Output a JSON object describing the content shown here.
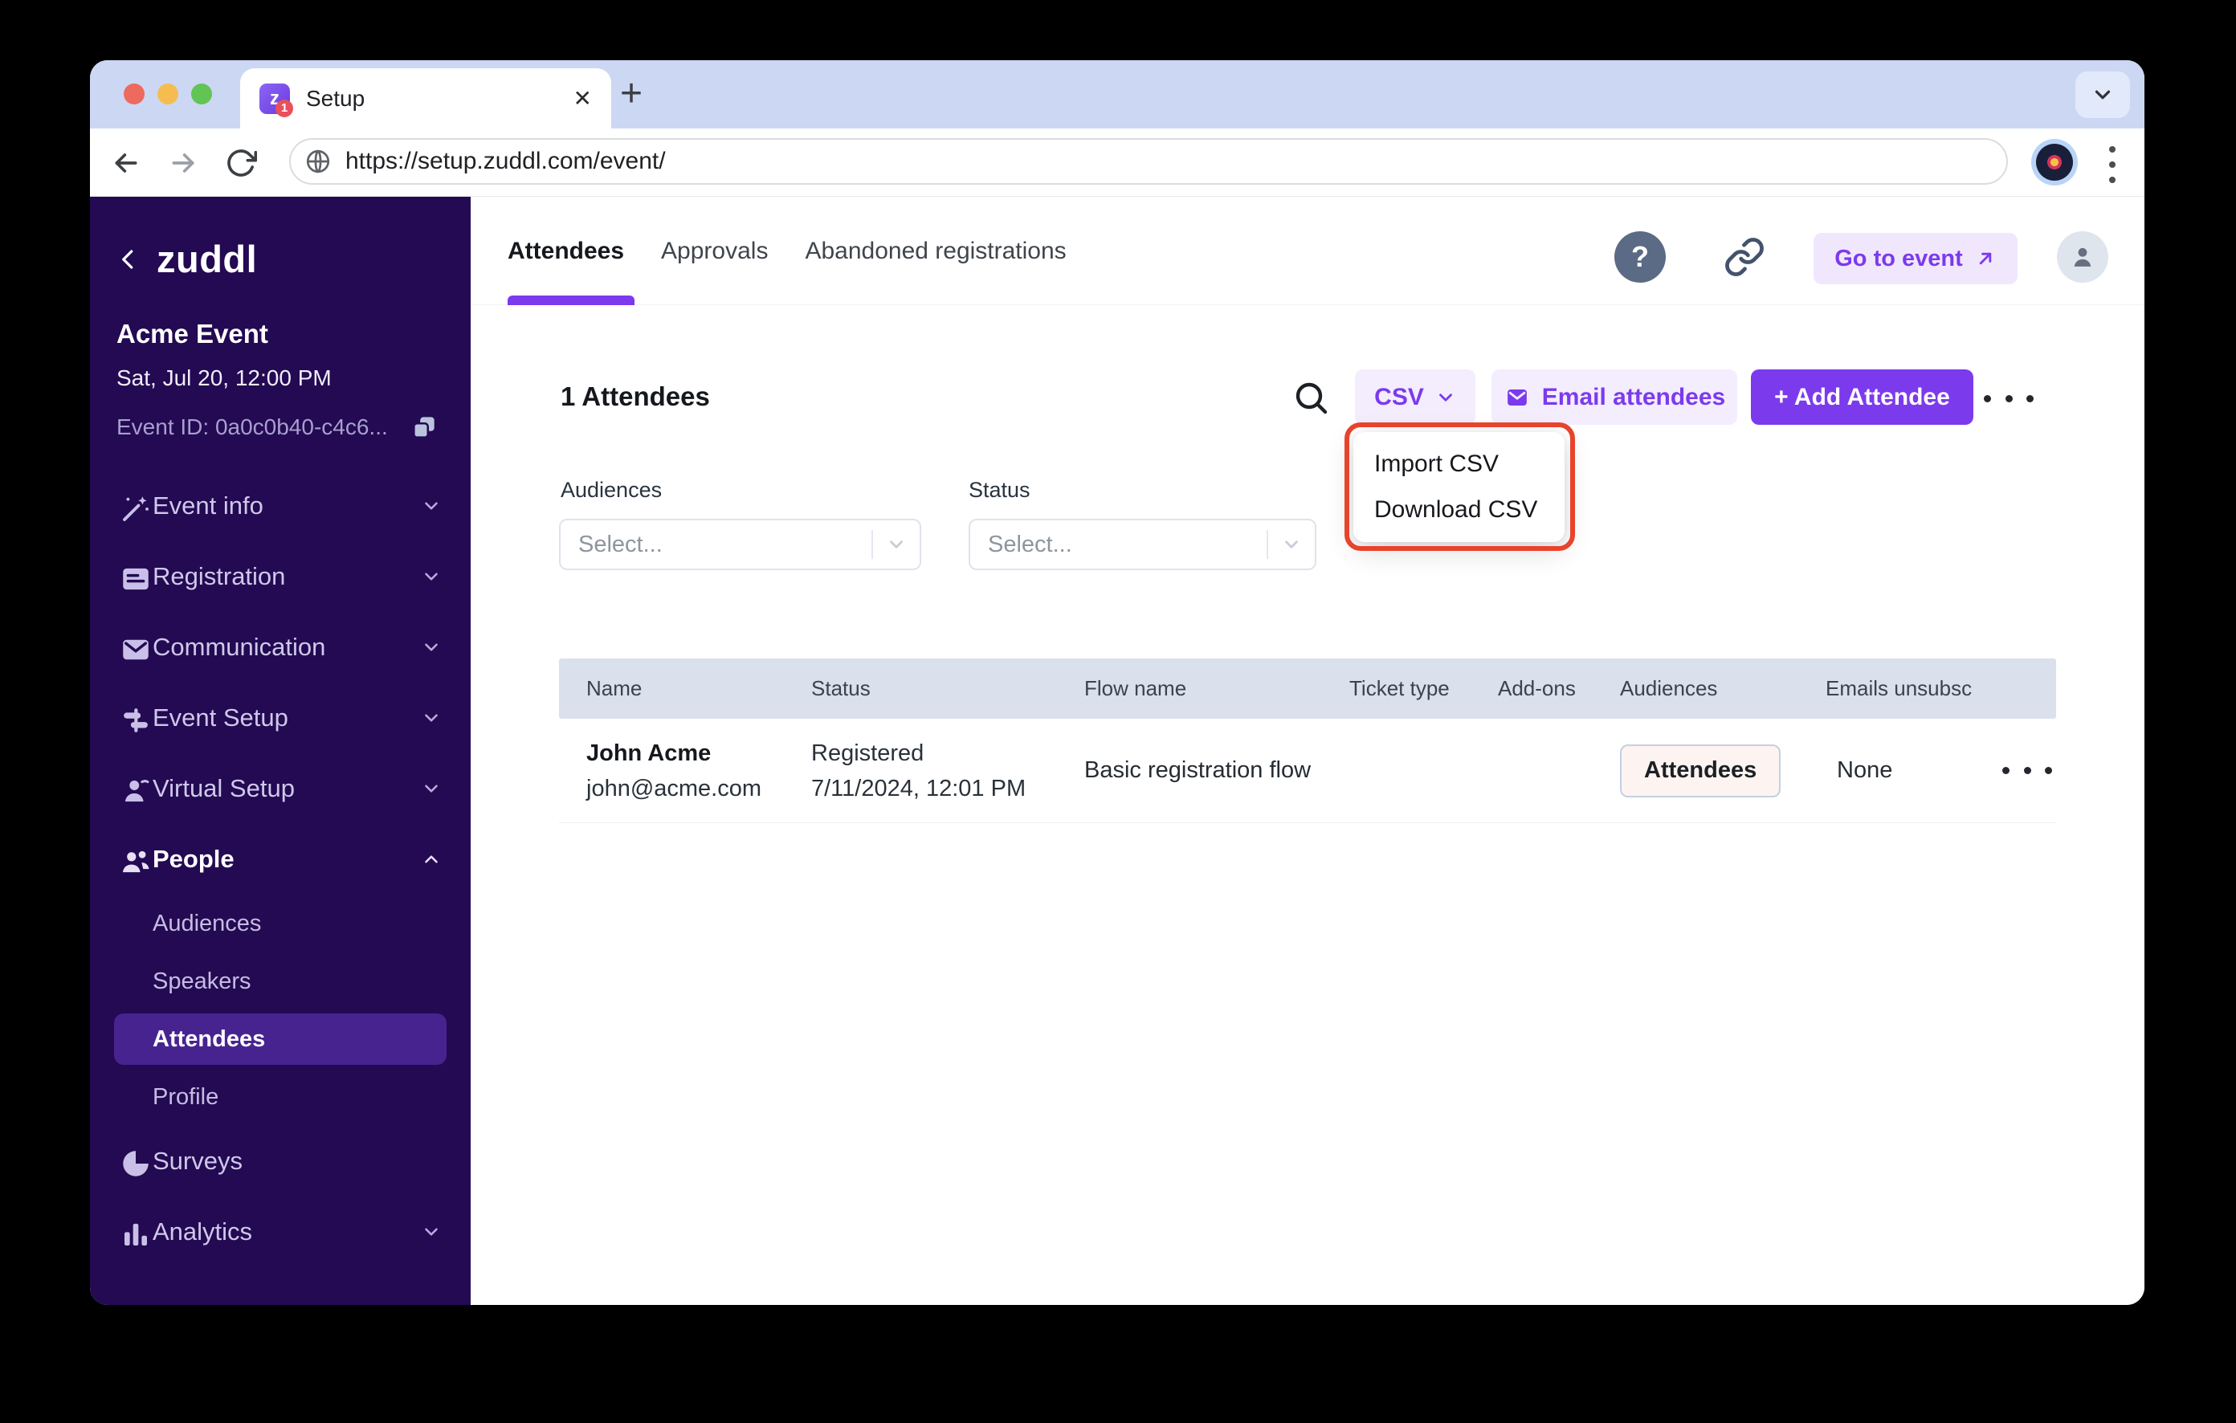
{
  "browser": {
    "tab_title": "Setup",
    "favicon_badge": "1",
    "url": "https://setup.zuddl.com/event/"
  },
  "sidebar": {
    "logo_text": "zuddl",
    "event_name": "Acme Event",
    "event_datetime": "Sat, Jul 20, 12:00 PM",
    "event_id": "Event ID: 0a0c0b40-c4c6...",
    "nav": [
      {
        "label": "Event info"
      },
      {
        "label": "Registration"
      },
      {
        "label": "Communication"
      },
      {
        "label": "Event Setup"
      },
      {
        "label": "Virtual Setup"
      },
      {
        "label": "People"
      },
      {
        "label": "Audiences"
      },
      {
        "label": "Speakers"
      },
      {
        "label": "Attendees"
      },
      {
        "label": "Profile"
      },
      {
        "label": "Surveys"
      },
      {
        "label": "Analytics"
      }
    ]
  },
  "header": {
    "tabs": [
      {
        "label": "Attendees"
      },
      {
        "label": "Approvals"
      },
      {
        "label": "Abandoned registrations"
      }
    ],
    "help_label": "?",
    "go_to_event_label": "Go to event"
  },
  "toolbar": {
    "count_title": "1 Attendees",
    "csv_label": "CSV",
    "email_label": "Email attendees",
    "add_label": "+ Add Attendee"
  },
  "csv_menu": {
    "items": [
      {
        "label": "Import CSV"
      },
      {
        "label": "Download CSV"
      }
    ]
  },
  "filters": {
    "audiences_label": "Audiences",
    "audiences_placeholder": "Select...",
    "status_label": "Status",
    "status_placeholder": "Select..."
  },
  "table": {
    "columns": [
      "Name",
      "Status",
      "Flow name",
      "Ticket type",
      "Add-ons",
      "Audiences",
      "Emails unsubsc"
    ],
    "rows": [
      {
        "name": "John Acme",
        "email": "john@acme.com",
        "status": "Registered",
        "registered_at": "7/11/2024, 12:01 PM",
        "flow_name": "Basic registration flow",
        "ticket_type": "",
        "add_ons": "",
        "audiences_badge": "Attendees",
        "emails_unsubscribed": "None"
      }
    ]
  },
  "colors": {
    "accent_purple": "#7c3aed",
    "light_purple_button_bg": "#f3edfe",
    "sidebar_bg": "#230a52",
    "selected_nav_bg": "#472390",
    "tabstrip_lavender": "#ccd7f3",
    "table_header_bg": "#dae0ec",
    "badge_bg": "#fdf3f0",
    "annotation_red": "#e8432b"
  },
  "icons": {
    "traffic-lights": "red/yellow/green circles",
    "plus-icon": "+",
    "close-icon": "✕",
    "chevron-down-icon": "⌄",
    "chevron-up-icon": "⌃",
    "chevron-left-icon": "‹",
    "back-icon": "←",
    "forward-icon": "→",
    "refresh-icon": "⟳",
    "globe-icon": "globe",
    "copy-icon": "overlapping squares",
    "wand-icon": "magic wand",
    "form-icon": "card with lines",
    "envelope-icon": "mail",
    "signpost-icon": "sliders",
    "person-icon": "person",
    "people-icon": "two people",
    "pie-icon": "pie chart",
    "bar-chart-icon": "bars",
    "search-icon": "magnifier",
    "help-icon": "? in circle",
    "link-icon": "chain",
    "external-arrow-icon": "↗",
    "more-horizontal-icon": "•••",
    "more-vertical-icon": "⋮"
  }
}
